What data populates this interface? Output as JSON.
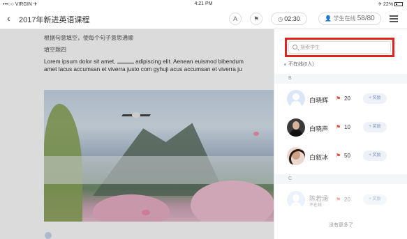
{
  "status_bar": {
    "carrier": "•••○○ VIRGIN ✈",
    "time": "4:21 PM",
    "battery": "✈ 22%"
  },
  "nav": {
    "title": "2017年新进英语课程",
    "icon_a": "A",
    "icon_flag": "⚑",
    "timer": "02:30",
    "students_label": "学生在线",
    "students_count": "58/80"
  },
  "content": {
    "hint": "根据句意填空，使每个句子意思通顺",
    "label": "填空题四",
    "text_line1_a": "Lorem ipsum dolor sit amet, ",
    "text_line1_b": " adipiscing elit. Aenean euismod bibendum",
    "text_line2": "amet lacus accumsan et viverra justo com gyhuji  acus accumsan et viverra ju"
  },
  "panel": {
    "search_placeholder": "搜索学生",
    "offline": "不在线(0人)",
    "groups": [
      {
        "letter": "B",
        "students": [
          {
            "name": "白晓辉",
            "score": "20",
            "add": "+ 奖励"
          },
          {
            "name": "白晓声",
            "score": "10",
            "add": "+ 奖励"
          },
          {
            "name": "白叙冰",
            "score": "50",
            "add": "+ 奖励"
          }
        ]
      },
      {
        "letter": "C",
        "students": [
          {
            "name": "陈若涵",
            "sub": "不在线",
            "score": "20",
            "add": "+ 奖励"
          }
        ]
      }
    ],
    "footer": "没有更多了"
  },
  "colors": {
    "highlight": "#e0231c",
    "flag": "#e24b3b",
    "accent": "#7c93bd"
  }
}
